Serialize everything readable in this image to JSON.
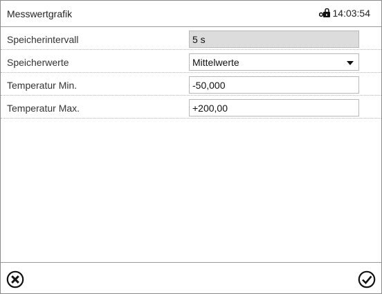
{
  "header": {
    "title": "Messwertgrafik",
    "time": "14:03:54",
    "icons": {
      "status": "lock-icon"
    }
  },
  "settings": [
    {
      "label": "Speicherintervall",
      "value": "5 s",
      "type": "readonly"
    },
    {
      "label": "Speicherwerte",
      "value": "Mittelwerte",
      "type": "dropdown"
    },
    {
      "label": "Temperatur Min.",
      "value": "-50,000",
      "type": "input"
    },
    {
      "label": "Temperatur Max.",
      "value": "+200,00",
      "type": "input"
    }
  ],
  "footer": {
    "icons": {
      "cancel": "cancel-icon",
      "confirm": "confirm-icon"
    }
  },
  "colors": {
    "border": "#9a9a9a",
    "readonly_field": "#dcdcdc",
    "text": "#1a1a1a"
  }
}
